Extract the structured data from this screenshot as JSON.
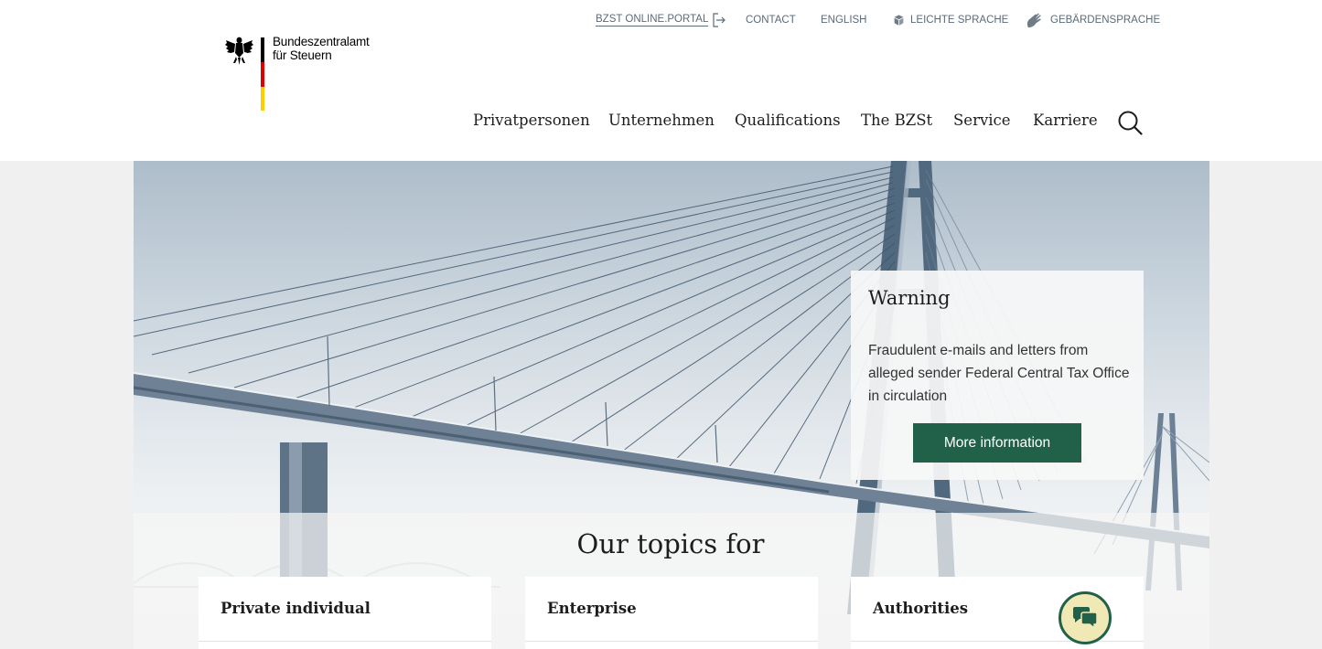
{
  "logo": {
    "line1": "Bundeszentralamt",
    "line2": "für Steuern",
    "eagle_icon": "federal-eagle-icon"
  },
  "toplinks": {
    "portal": "BZST ONLINE.PORTAL",
    "contact": "CONTACT",
    "english": "ENGLISH",
    "easy_language": "LEICHTE SPRACHE",
    "sign_language": "GEBÄRDENSPRACHE"
  },
  "nav": {
    "items": [
      "Privatpersonen",
      "Unternehmen",
      "Qualifications",
      "The BZSt",
      "Service",
      "Karriere"
    ],
    "search_icon": "search-icon"
  },
  "warning": {
    "title": "Warning",
    "text": "Fraudulent e-mails and letters from alleged sender Federal Central Tax Office in circulation",
    "button": "More information"
  },
  "topics": {
    "title": "Our topics for",
    "cards": [
      "Private individual",
      "Enterprise",
      "Authorities"
    ]
  },
  "colors": {
    "accent": "#21614a",
    "chat_bg": "#f1e9b5",
    "toplink": "#5a6b7b"
  },
  "chat_icon": "chat-bubbles-icon"
}
